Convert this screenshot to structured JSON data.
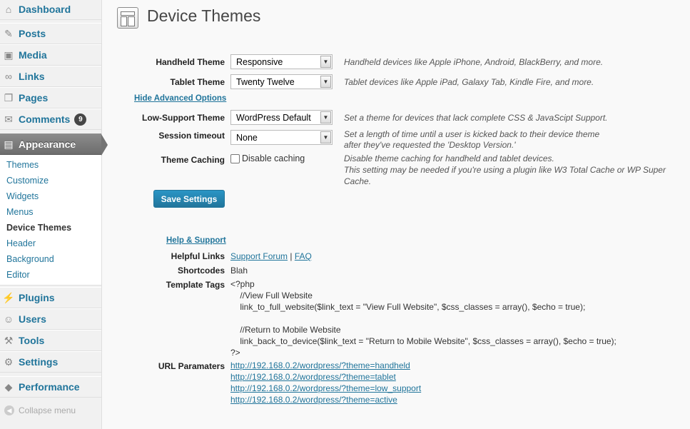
{
  "sidebar": {
    "items": [
      {
        "label": "Dashboard",
        "icon": "dashboard-icon",
        "glyph": "⌂"
      },
      {
        "label": "Posts",
        "icon": "pin-icon",
        "glyph": "✎"
      },
      {
        "label": "Media",
        "icon": "media-icon",
        "glyph": "▣"
      },
      {
        "label": "Links",
        "icon": "link-icon",
        "glyph": "∞"
      },
      {
        "label": "Pages",
        "icon": "pages-icon",
        "glyph": "❐"
      },
      {
        "label": "Comments",
        "icon": "comment-icon",
        "glyph": "✉",
        "badge": "9"
      },
      {
        "label": "Appearance",
        "icon": "appearance-icon",
        "glyph": "▤"
      },
      {
        "label": "Plugins",
        "icon": "plugin-icon",
        "glyph": "⚡"
      },
      {
        "label": "Users",
        "icon": "users-icon",
        "glyph": "☺"
      },
      {
        "label": "Tools",
        "icon": "tools-icon",
        "glyph": "⚒"
      },
      {
        "label": "Settings",
        "icon": "settings-icon",
        "glyph": "⚙"
      },
      {
        "label": "Performance",
        "icon": "performance-icon",
        "glyph": "◆"
      }
    ],
    "submenu": [
      "Themes",
      "Customize",
      "Widgets",
      "Menus",
      "Device Themes",
      "Header",
      "Background",
      "Editor"
    ],
    "collapse_label": "Collapse menu"
  },
  "page": {
    "title": "Device Themes"
  },
  "form": {
    "handheld": {
      "label": "Handheld Theme",
      "value": "Responsive",
      "desc": "Handheld devices like Apple iPhone, Android, BlackBerry, and more."
    },
    "tablet": {
      "label": "Tablet Theme",
      "value": "Twenty Twelve",
      "desc": "Tablet devices like Apple iPad, Galaxy Tab, Kindle Fire, and more."
    },
    "advanced_link": "Hide Advanced Options",
    "lowsupport": {
      "label": "Low-Support Theme",
      "value": "WordPress Default",
      "desc": "Set a theme for devices that lack complete CSS & JavaScipt Support."
    },
    "session": {
      "label": "Session timeout",
      "value": "None",
      "desc1": "Set a length of time until a user is kicked back to their device theme",
      "desc2": "after they've requested the 'Desktop Version.'"
    },
    "caching": {
      "label": "Theme Caching",
      "checkbox_label": "Disable caching",
      "desc1": "Disable theme caching for handheld and tablet devices.",
      "desc2": "This setting may be needed if you're using a plugin like W3 Total Cache or WP Super",
      "desc3": "Cache."
    },
    "save_label": "Save Settings"
  },
  "help": {
    "title": "Help & Support",
    "helpful_links_label": "Helpful Links",
    "support_forum": "Support Forum",
    "separator": "|",
    "faq": "FAQ",
    "shortcodes_label": "Shortcodes",
    "shortcodes_value": "Blah",
    "template_tags_label": "Template Tags",
    "template_tags_code": "<?php\n    //View Full Website\n    link_to_full_website($link_text = \"View Full Website\", $css_classes = array(), $echo = true);\n\n    //Return to Mobile Website\n    link_back_to_device($link_text = \"Return to Mobile Website\", $css_classes = array(), $echo = true);\n?>",
    "url_params_label": "URL Paramaters",
    "urls": [
      "http://192.168.0.2/wordpress/?theme=handheld",
      "http://192.168.0.2/wordpress/?theme=tablet",
      "http://192.168.0.2/wordpress/?theme=low_support",
      "http://192.168.0.2/wordpress/?theme=active"
    ]
  },
  "colors": {
    "link": "#21759b",
    "active_menu": "#777777",
    "button": "#21759b"
  }
}
